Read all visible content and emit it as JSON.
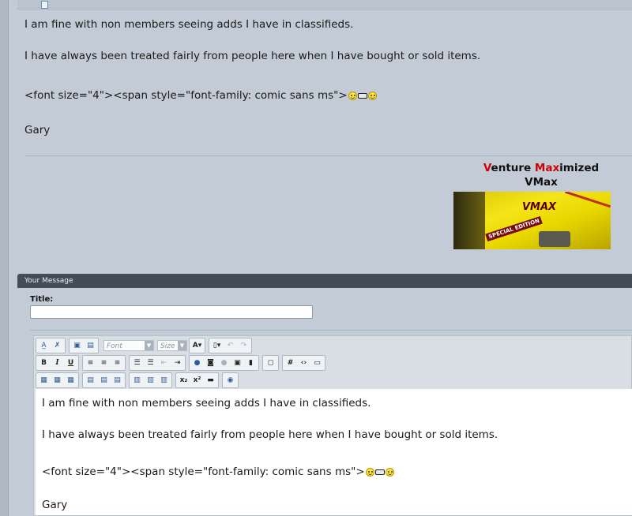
{
  "post": {
    "line1": "I am fine with non members seeing adds I have in classifieds.",
    "line2": "I have always been treated fairly from people here when I have bought or sold items.",
    "line3": "<font size=\"4\"><span style=\"font-family: comic sans ms\">",
    "line4": "Gary"
  },
  "signature": {
    "part1_red": "V",
    "part1_rest": "enture ",
    "part2_red": "Max",
    "part2_rest": "imized",
    "line2": "VMax",
    "banner_logo": "VMAX",
    "banner_badge": "SPECIAL EDITION"
  },
  "editor": {
    "header": "Your Message",
    "title_label": "Title:",
    "title_value": "",
    "font_placeholder": "Font",
    "size_placeholder": "Size"
  },
  "editor_content": {
    "line1": "I am fine with non members seeing adds I have in classifieds.",
    "line2": "I have always been treated fairly from people here when I have bought or sold items.",
    "line3": "<font size=\"4\"><span style=\"font-family: comic sans ms\">",
    "line4": "Gary"
  },
  "colors": {
    "page_bg": "#c2ccd6",
    "header_bg": "#444d57",
    "accent_red": "#d00000"
  }
}
